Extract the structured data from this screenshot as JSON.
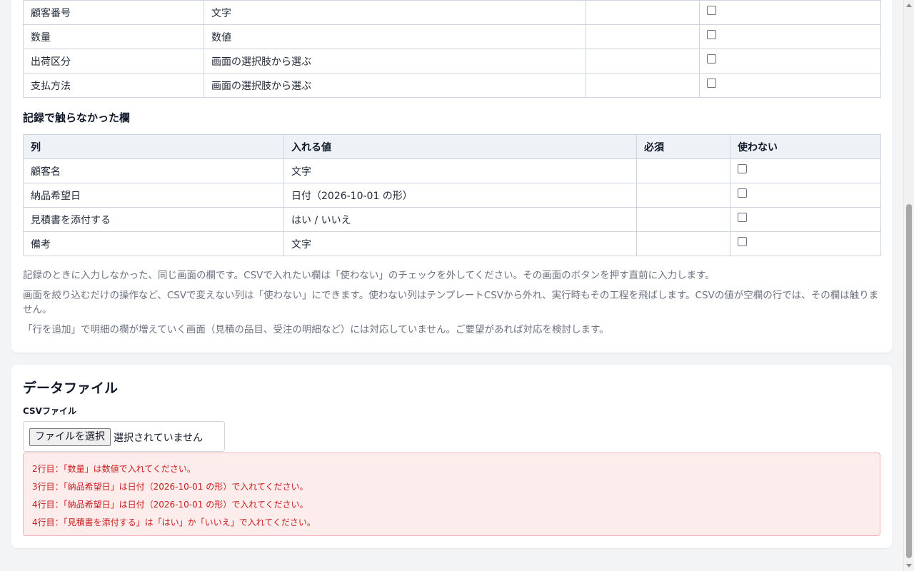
{
  "recorded_fields": {
    "rows": [
      {
        "column": "顧客番号",
        "value_type": "文字"
      },
      {
        "column": "数量",
        "value_type": "数値"
      },
      {
        "column": "出荷区分",
        "value_type": "画面の選択肢から選ぶ"
      },
      {
        "column": "支払方法",
        "value_type": "画面の選択肢から選ぶ"
      }
    ]
  },
  "untouched_fields": {
    "title": "記録で触らなかった欄",
    "headers": {
      "column": "列",
      "value": "入れる値",
      "required": "必須",
      "unused": "使わない"
    },
    "rows": [
      {
        "column": "顧客名",
        "value_type": "文字"
      },
      {
        "column": "納品希望日",
        "value_type": "日付（2026-10-01 の形）"
      },
      {
        "column": "見積書を添付する",
        "value_type": "はい / いいえ"
      },
      {
        "column": "備考",
        "value_type": "文字"
      }
    ]
  },
  "notes": [
    "記録のときに入力しなかった、同じ画面の欄です。CSVで入れたい欄は「使わない」のチェックを外してください。その画面のボタンを押す直前に入力します。",
    "画面を絞り込むだけの操作など、CSVで変えない列は「使わない」にできます。使わない列はテンプレートCSVから外れ、実行時もその工程を飛ばします。CSVの値が空欄の行では、その欄は触りません。",
    "「行を追加」で明細の欄が増えていく画面（見積の品目、受注の明細など）には対応していません。ご要望があれば対応を検討します。"
  ],
  "data_file": {
    "title": "データファイル",
    "csv_label": "CSVファイル",
    "choose_button": "ファイルを選択",
    "no_file": "選択されていません",
    "errors": [
      "2行目：「数量」は数値で入れてください。",
      "3行目：「納品希望日」は日付（2026-10-01 の形）で入れてください。",
      "4行目：「納品希望日」は日付（2026-10-01 の形）で入れてください。",
      "4行目：「見積書を添付する」は「はい」か「いいえ」で入れてください。"
    ]
  },
  "colors": {
    "error_text": "#c81e1e",
    "error_bg": "#fdecec",
    "header_bg": "#eef2f7"
  }
}
